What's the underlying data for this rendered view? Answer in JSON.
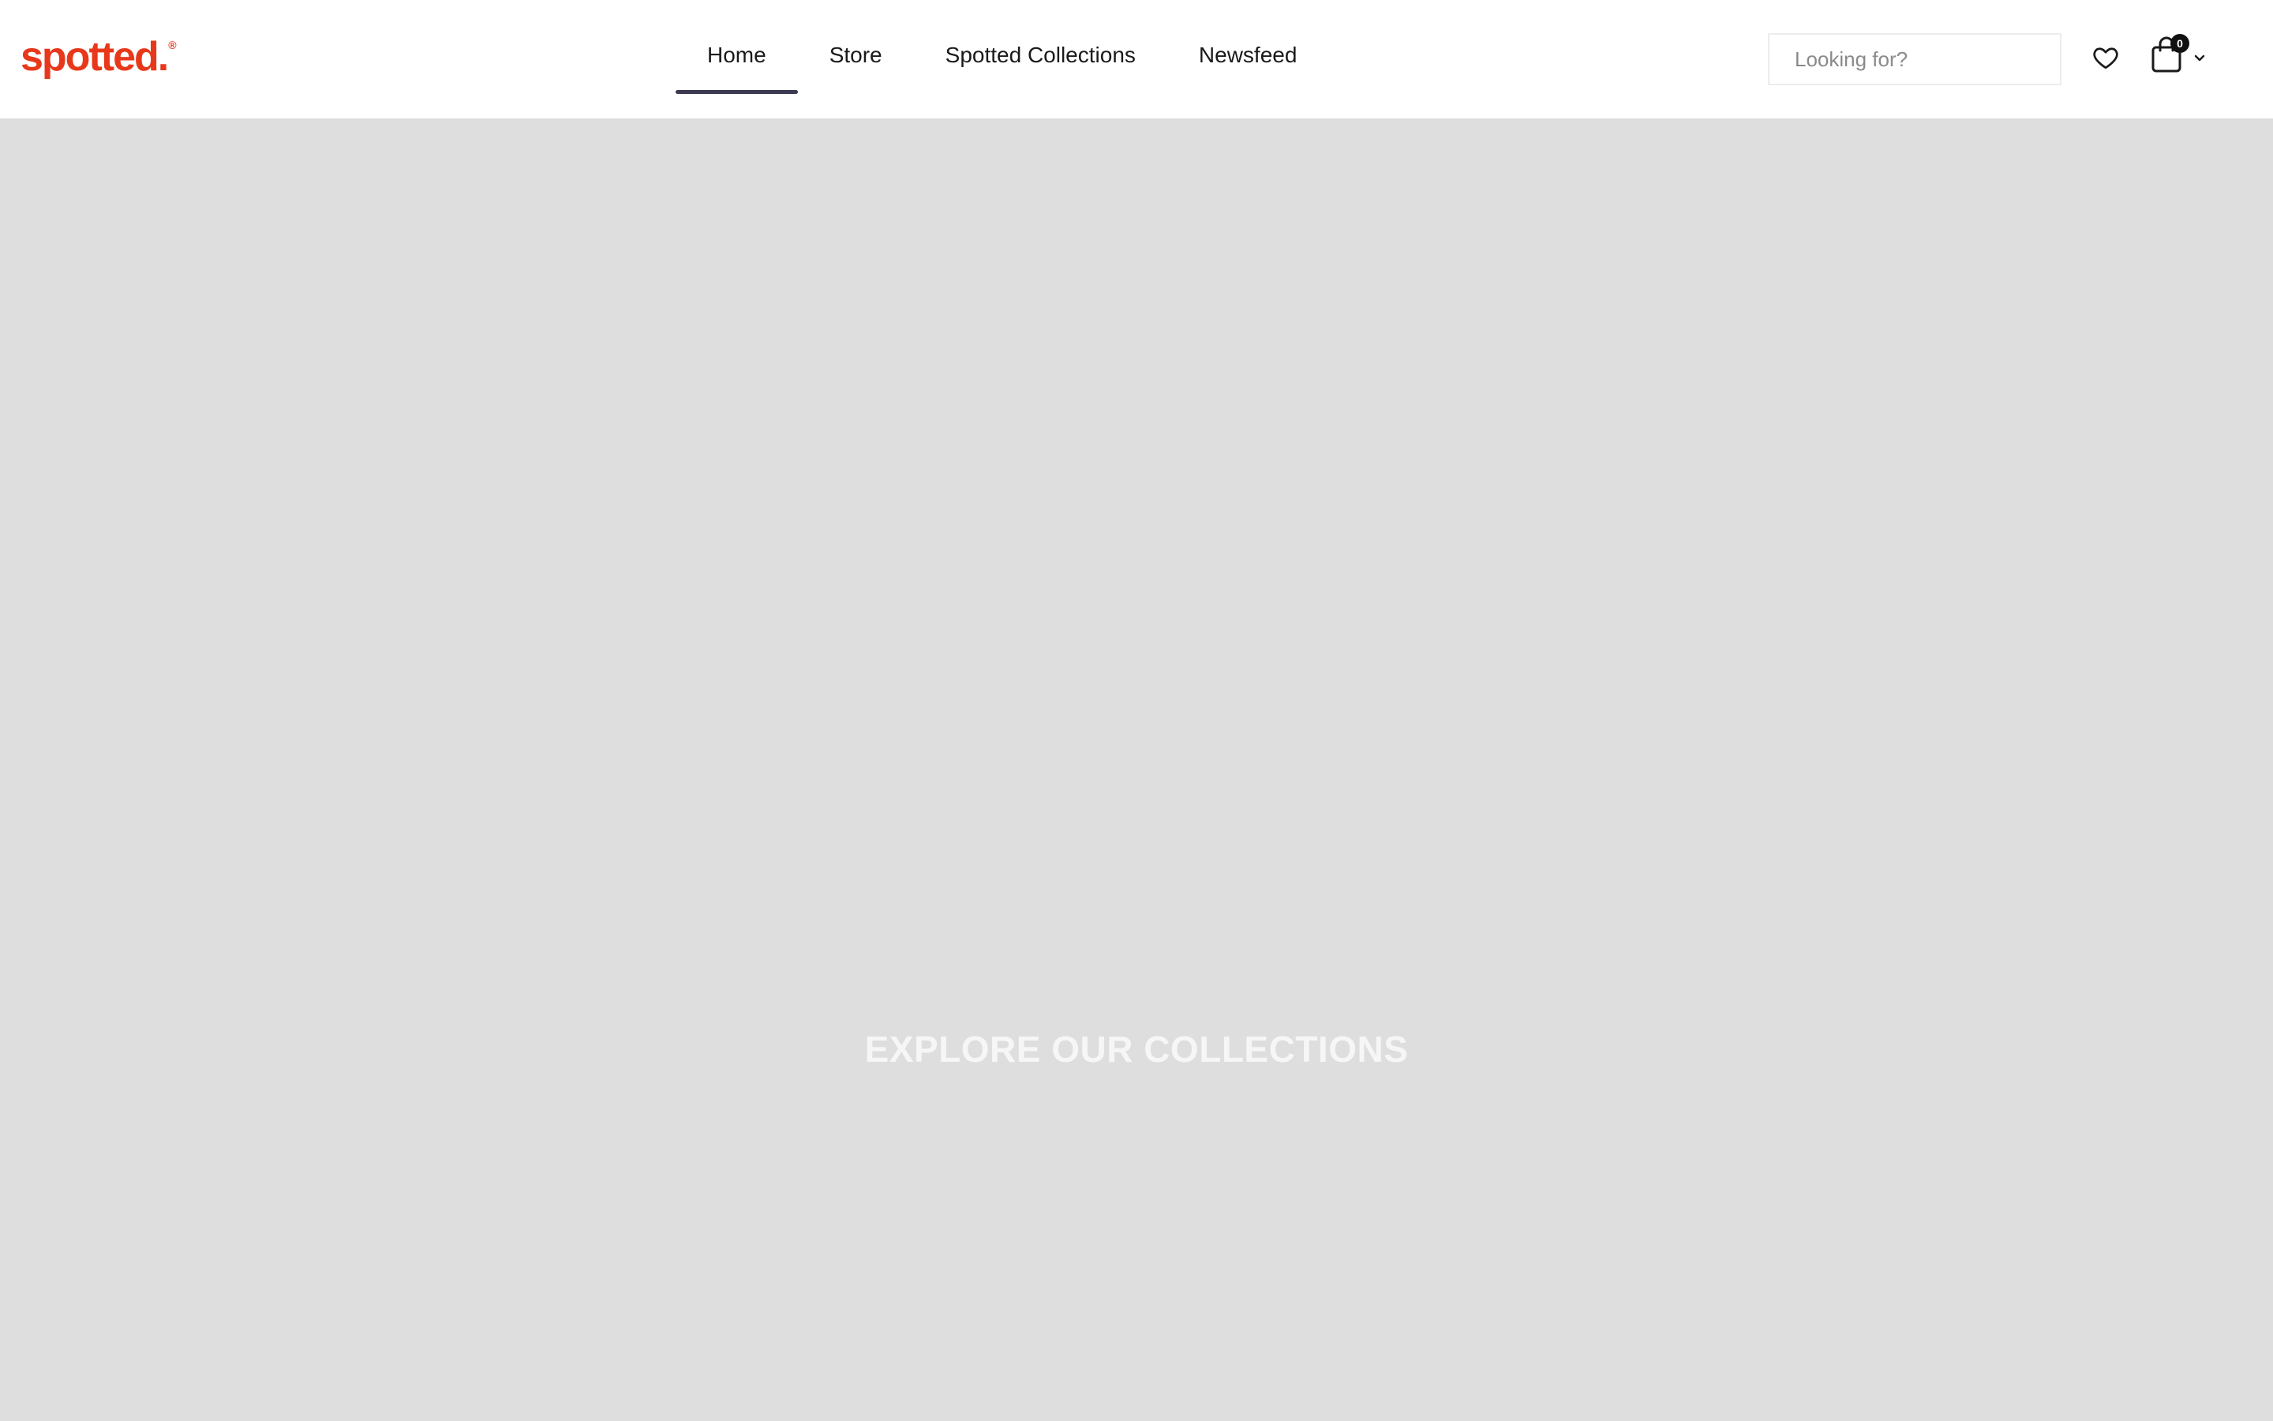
{
  "brand": {
    "logo_text": "spotted.",
    "registered_mark": "®",
    "color": "#e8381b"
  },
  "nav": {
    "items": [
      {
        "label": "Home",
        "active": true
      },
      {
        "label": "Store",
        "active": false
      },
      {
        "label": "Spotted Collections",
        "active": false
      },
      {
        "label": "Newsfeed",
        "active": false
      }
    ],
    "active_underline_color": "#3b3a52"
  },
  "search": {
    "placeholder": "Looking for?",
    "value": ""
  },
  "icons": {
    "wishlist": "heart-icon",
    "cart": "shopping-bag-icon",
    "cart_menu": "chevron-down-icon"
  },
  "cart": {
    "count": "0"
  },
  "hero": {
    "background_color": "#dedede",
    "title": "EXPLORE OUR COLLECTIONS"
  }
}
